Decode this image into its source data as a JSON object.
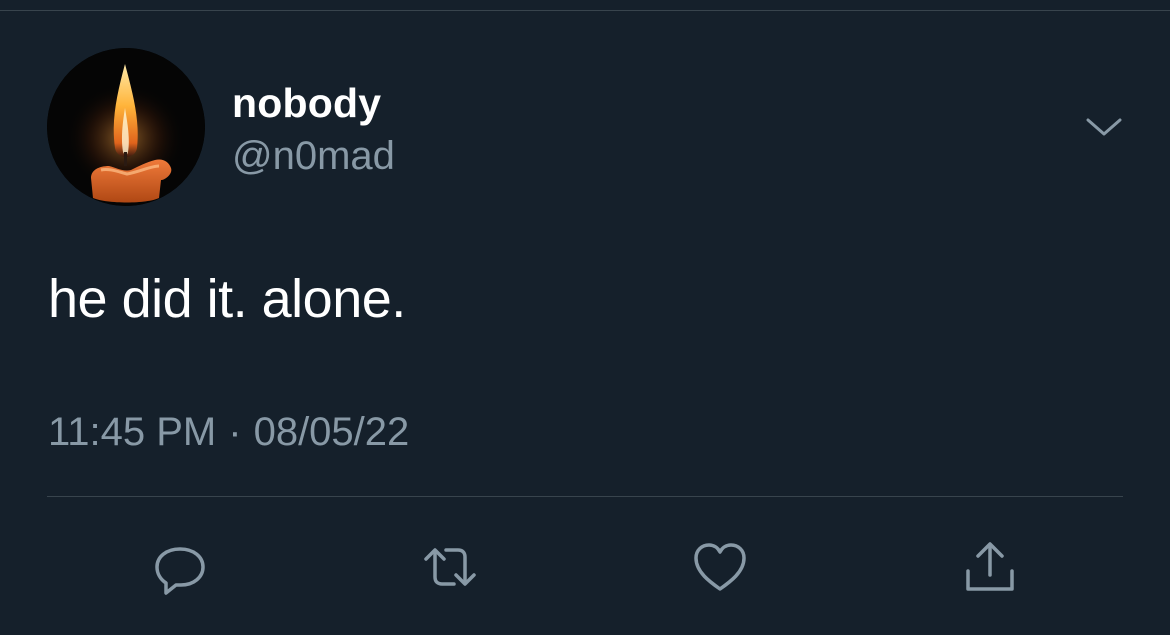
{
  "tweet": {
    "display_name": "nobody",
    "handle": "@n0mad",
    "text": "he did it. alone.",
    "time": "11:45 PM",
    "separator": "·",
    "date": "08/05/22"
  },
  "icons": {
    "avatar": "candle-flame",
    "more": "chevron-down-icon",
    "reply": "reply-icon",
    "retweet": "retweet-icon",
    "like": "heart-icon",
    "share": "share-icon"
  },
  "colors": {
    "background": "#15202b",
    "primary_text": "#ffffff",
    "secondary_text": "#8899a6",
    "divider": "#38444d"
  }
}
